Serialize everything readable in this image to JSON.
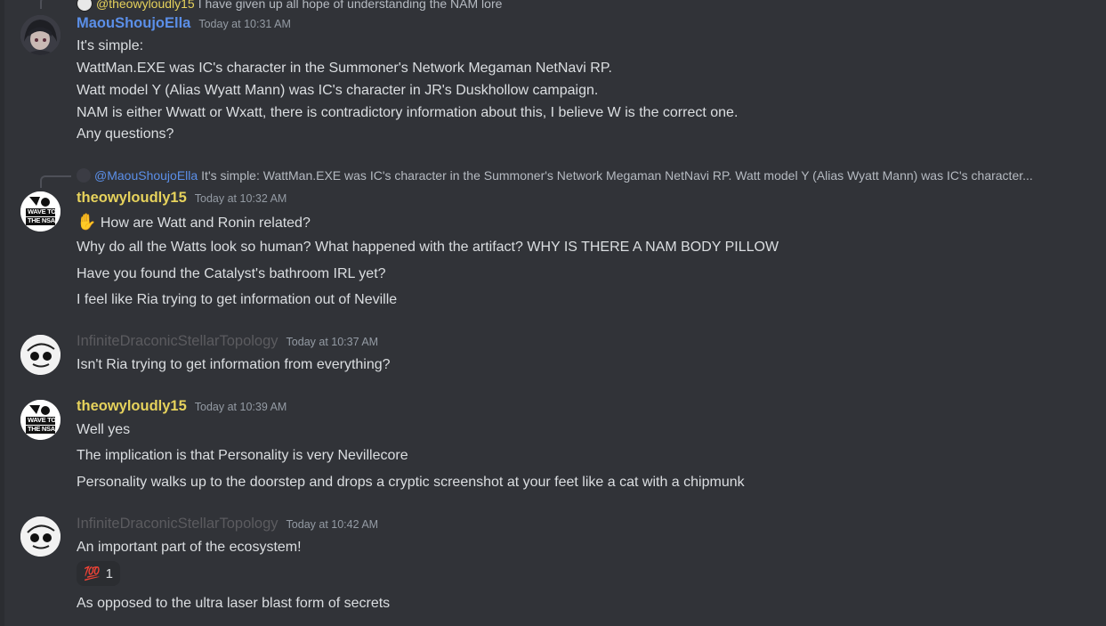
{
  "colors": {
    "background": "#313338",
    "blue_user": "#5b8fe8",
    "yellow_user": "#e6d25c",
    "gray_user": "#5b5b5f",
    "text": "#dbdee1",
    "timestamp": "#949ba4"
  },
  "top_reply": {
    "name": "@theowyloudly15",
    "preview": "I have given up all hope of understanding the NAM lore"
  },
  "messages": [
    {
      "author": "MaouShoujoElla",
      "timestamp": "Today at 10:31 AM",
      "avatar_icon": "dark-hooded-girl-avatar",
      "lines": [
        "It's simple:",
        "WattMan.EXE was IC's character in the Summoner's Network Megaman NetNavi RP.",
        "Watt model Y (Alias Wyatt Mann) was IC's character in JR's Duskhollow campaign.",
        "NAM is either Wwatt or Wxatt, there is contradictory information about this, I believe W is the correct one.",
        "Any questions?"
      ]
    },
    {
      "reply": {
        "name": "@MaouShoujoElla",
        "preview": "It's simple: WattMan.EXE was IC's character in the Summoner's Network Megaman NetNavi RP. Watt model Y (Alias Wyatt Mann) was IC's character..."
      },
      "author": "theowyloudly15",
      "timestamp": "Today at 10:32 AM",
      "avatar_icon": "wave-to-the-nsa-avatar",
      "avatar_text_1": "WAVE TO",
      "avatar_text_2": "THE NSA",
      "emoji": "✋",
      "lines": [
        "How are Watt and Ronin related?",
        "Why do all the Watts look so human? What happened with the artifact? WHY IS THERE A NAM BODY PILLOW",
        "Have you found the Catalyst's bathroom IRL yet?",
        "I feel like Ria trying to get information out of Neville"
      ]
    },
    {
      "author": "InfiniteDraconicStellarTopology",
      "timestamp": "Today at 10:37 AM",
      "avatar_icon": "sketch-face-avatar",
      "lines": [
        "Isn't Ria trying to get information from everything?"
      ]
    },
    {
      "author": "theowyloudly15",
      "timestamp": "Today at 10:39 AM",
      "avatar_icon": "wave-to-the-nsa-avatar",
      "avatar_text_1": "WAVE TO",
      "avatar_text_2": "THE NSA",
      "lines": [
        "Well yes",
        "The implication is that Personality is very Nevillecore",
        "Personality walks up to the doorstep and drops a cryptic screenshot at your feet like a cat with a chipmunk"
      ]
    },
    {
      "author": "InfiniteDraconicStellarTopology",
      "timestamp": "Today at 10:42 AM",
      "avatar_icon": "sketch-face-avatar",
      "lines": [
        "An important part of the ecosystem!",
        "As opposed to the ultra laser blast form of secrets"
      ],
      "reaction": {
        "emoji": "💯",
        "count": "1"
      }
    }
  ]
}
